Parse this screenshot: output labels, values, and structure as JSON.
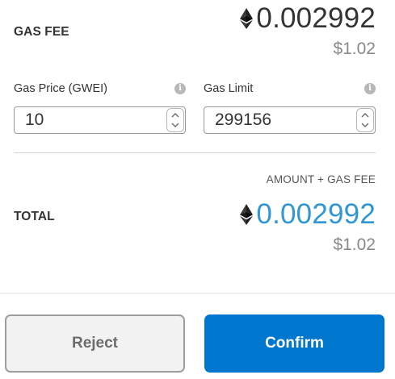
{
  "gas_fee": {
    "label": "GAS FEE",
    "eth_amount": "0.002992",
    "usd_amount": "$1.02"
  },
  "gas_price": {
    "label": "Gas Price (GWEI)",
    "value": "10",
    "info_icon": "info-icon"
  },
  "gas_limit": {
    "label": "Gas Limit",
    "value": "299156",
    "info_icon": "info-icon"
  },
  "total": {
    "caption": "AMOUNT + GAS FEE",
    "label": "TOTAL",
    "eth_amount": "0.002992",
    "usd_amount": "$1.02"
  },
  "actions": {
    "reject_label": "Reject",
    "confirm_label": "Confirm"
  },
  "colors": {
    "accent_blue": "#0077cf",
    "total_blue": "#2f97d4",
    "muted_text": "#898989"
  }
}
